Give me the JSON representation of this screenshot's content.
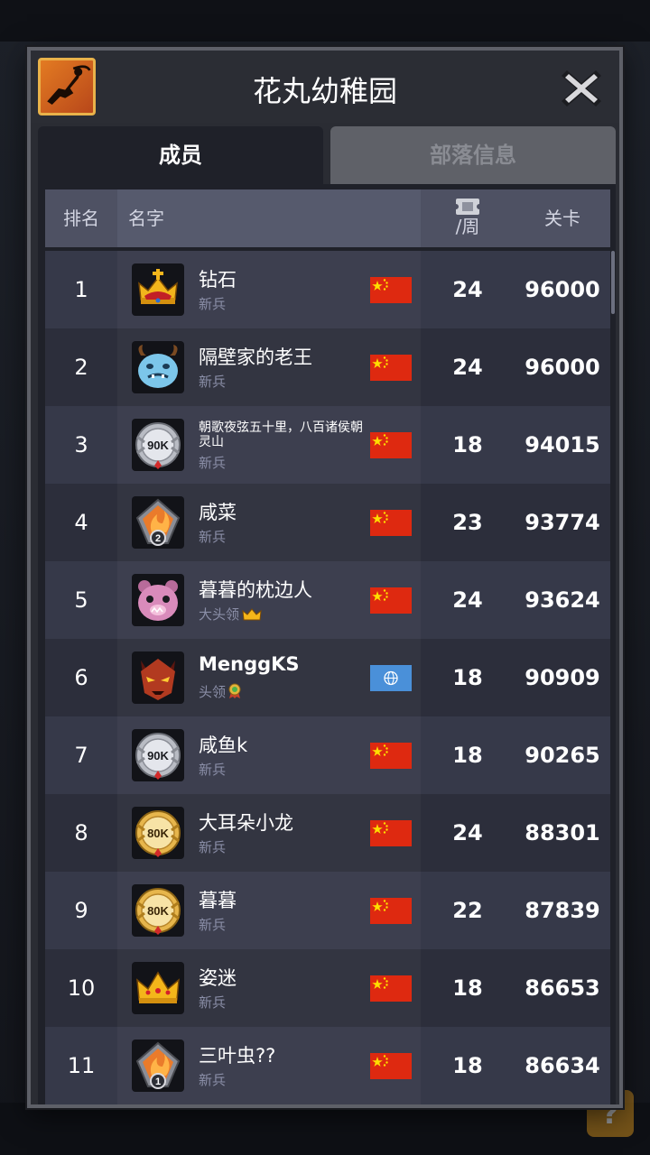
{
  "dialog": {
    "title": "花丸幼稚园",
    "emblem_icon": "ninja-emblem-icon",
    "close_icon": "close-x-icon"
  },
  "tabs": [
    {
      "label": "成员",
      "active": true
    },
    {
      "label": "部落信息",
      "active": false
    }
  ],
  "table": {
    "headers": {
      "rank": "排名",
      "name": "名字",
      "weekly_icon": "ticket-icon",
      "weekly": "/周",
      "stage": "关卡"
    },
    "rows": [
      {
        "rank": "1",
        "name": "钻石",
        "role": "新兵",
        "avatar": "red-crown-avatar",
        "flag": "china-flag",
        "weekly": "24",
        "stage": "96000"
      },
      {
        "rank": "2",
        "name": "隔壁家的老王",
        "role": "新兵",
        "avatar": "blue-yeti-avatar",
        "flag": "china-flag",
        "weekly": "24",
        "stage": "96000"
      },
      {
        "rank": "3",
        "name": "朝歌夜弦五十里，八百诸侯朝灵山",
        "role": "新兵",
        "avatar": "silver-90k-badge",
        "badge_text": "90K",
        "flag": "china-flag",
        "weekly": "18",
        "stage": "94015"
      },
      {
        "rank": "4",
        "name": "咸菜",
        "role": "新兵",
        "avatar": "fire-gem-avatar",
        "badge_text": "2",
        "flag": "china-flag",
        "weekly": "23",
        "stage": "93774"
      },
      {
        "rank": "5",
        "name": "暮暮的枕边人",
        "role": "大头领",
        "role_icon": "crown-icon",
        "avatar": "pink-monster-avatar",
        "flag": "china-flag",
        "weekly": "24",
        "stage": "93624"
      },
      {
        "rank": "6",
        "name": "MenggKS",
        "role": "头领",
        "role_icon": "medal-icon",
        "avatar": "red-demon-avatar",
        "flag": "globe-flag",
        "weekly": "18",
        "stage": "90909"
      },
      {
        "rank": "7",
        "name": "咸鱼k",
        "role": "新兵",
        "avatar": "silver-90k-badge",
        "badge_text": "90K",
        "flag": "china-flag",
        "weekly": "18",
        "stage": "90265"
      },
      {
        "rank": "8",
        "name": "大耳朵小龙",
        "role": "新兵",
        "avatar": "gold-80k-badge",
        "badge_text": "80K",
        "flag": "china-flag",
        "weekly": "24",
        "stage": "88301"
      },
      {
        "rank": "9",
        "name": "暮暮",
        "role": "新兵",
        "avatar": "gold-80k-badge",
        "badge_text": "80K",
        "flag": "china-flag",
        "weekly": "22",
        "stage": "87839"
      },
      {
        "rank": "10",
        "name": "姿迷",
        "role": "新兵",
        "avatar": "gold-crown-avatar",
        "flag": "china-flag",
        "weekly": "18",
        "stage": "86653"
      },
      {
        "rank": "11",
        "name": "三叶虫??",
        "role": "新兵",
        "avatar": "fire-gem-avatar",
        "badge_text": "1",
        "flag": "china-flag",
        "weekly": "18",
        "stage": "86634"
      }
    ]
  },
  "colors": {
    "panel": "#2a2c33",
    "table_bg": "#1f2129",
    "row_odd": "#363949",
    "row_even": "#2c2e3b",
    "header": "#4e5163",
    "role_text": "#8b8fa8",
    "china_red": "#de2910",
    "china_star": "#ffde00",
    "globe_blue": "#4a90d9"
  },
  "background": {
    "help_glyph": "?"
  }
}
